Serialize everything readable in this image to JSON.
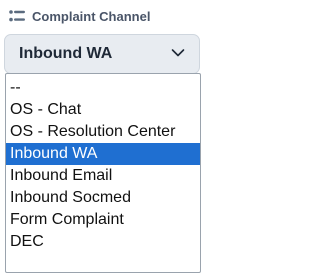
{
  "field": {
    "label": "Complaint Channel",
    "icon": "list-filter-icon",
    "selected_value": "Inbound WA"
  },
  "dropdown": {
    "options": [
      "--",
      "OS - Chat",
      "OS - Resolution Center",
      "Inbound WA",
      "Inbound Email",
      "Inbound Socmed",
      "Form Complaint",
      "DEC"
    ],
    "highlighted_index": 3
  },
  "colors": {
    "select_bg": "#e8ecf1",
    "highlight": "#1f6fd1",
    "label_text": "#4a5568"
  }
}
